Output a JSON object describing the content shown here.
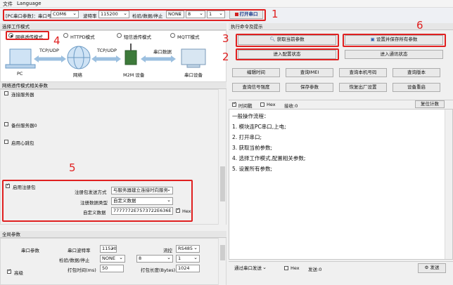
{
  "menu": {
    "file": "文件",
    "language": "Language"
  },
  "toolbar": {
    "port_params_label": "[PC串口参数]：串口号",
    "port": "COM6",
    "baud_label": "波特率",
    "baud": "115200",
    "parity_label": "检验/数据/停止",
    "parity": "NONE",
    "databits": "8",
    "stopbits": "1",
    "open_port": "打开串口"
  },
  "annotations": [
    "1",
    "2",
    "3",
    "4",
    "5",
    "6"
  ],
  "left": {
    "mode_title": "选择工作模式",
    "modes": [
      "网络透传模式",
      "HTTPD模式",
      "短信透传模式",
      "MQTT模式"
    ],
    "diagram": {
      "pc": "PC",
      "tcp_left": "TCP/UDP",
      "network": "网络",
      "tcp_right": "TCP/UDP",
      "device": "M2M 设备",
      "serial_data": "串口数据",
      "serial_device": "串口设备"
    },
    "params_title": "网络透传模式相关参数",
    "connect_server": "连接服务器",
    "backup_server": "备份服务器0",
    "heartbeat": "启用心跳包",
    "register_pack": "启用注册包",
    "reg_method_label": "注册包发送方式",
    "reg_method": "与服务器建立连接时向服务",
    "reg_type_label": "注册数据类型",
    "reg_type": "自定义数据",
    "custom_label": "自定义数据",
    "custom_value": "7777772E7573722E636E",
    "hex_label": "Hex"
  },
  "global": {
    "title": "全局参数",
    "serial_params": "串口参数",
    "baud_label": "串口波特率",
    "baud": "115200",
    "flow_label": "流控",
    "flow": "RS485",
    "parity_label": "检验/数据/停止",
    "parity": "NONE",
    "databits": "8",
    "stopbits": "1",
    "pack_time_label": "打包时间(ms)",
    "pack_time": "50",
    "pack_len_label": "打包长度(Bytes)",
    "pack_len": "1024",
    "advanced": "高级"
  },
  "right": {
    "title": "执行命令及提示",
    "get_params": "获取当前参数",
    "set_save": "设置并保存所有参数",
    "enter_config": "进入配置状态",
    "enter_comm": "进入通讯状态",
    "row1": [
      "编辑时间",
      "查询IMEI",
      "查询本机号码",
      "查询版本"
    ],
    "row2": [
      "查询信号强度",
      "保存参数",
      "恢复出厂设置",
      "设备重启"
    ],
    "timestamp": "时间戳",
    "hex": "Hex",
    "receive": "接收:0",
    "reset_count": "复位计数",
    "steps": [
      "一般操作流程：",
      "1. 模块连PC串口,上电;",
      "2. 打开串口;",
      "3. 获取当前参数;",
      "4. 选择工作模式,配置相关参数;",
      "5. 设置所有参数;"
    ],
    "send_via": "通过串口发送",
    "send_hex": "Hex",
    "send_count": "发送:0",
    "send": "发送"
  }
}
